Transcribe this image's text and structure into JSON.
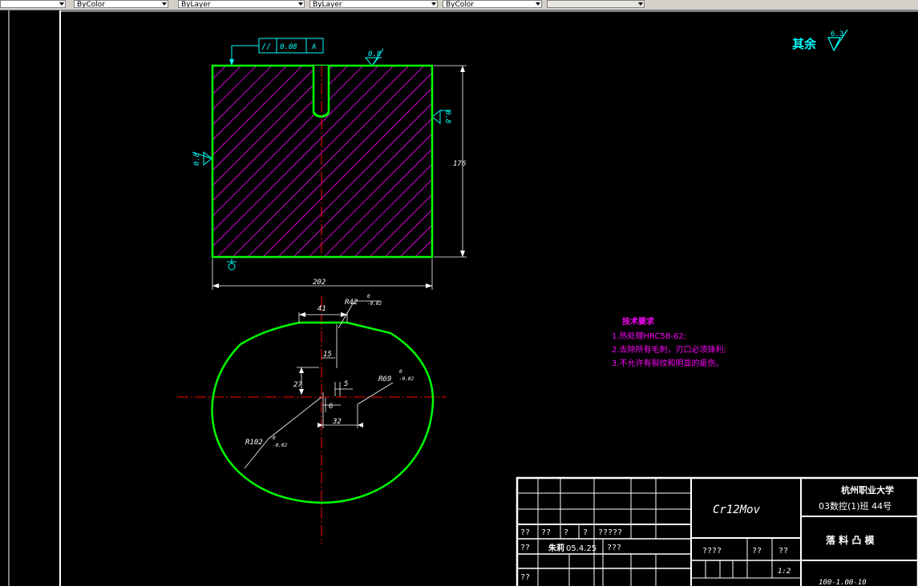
{
  "toolbar": {
    "color_label": "ByColor",
    "linetype_label": "ByLayer",
    "lineweight_label": "ByLayer",
    "plotstyle_label": "ByColor"
  },
  "drawing": {
    "rest_roughness_label": "其余",
    "rest_roughness_value": "6.3",
    "flatness_symbol": "//",
    "flatness_value": "0.08",
    "flatness_datum": "A",
    "roughness_top": "0.8",
    "roughness_left": "0.8",
    "roughness_right": "0.8",
    "dim_height": "176",
    "dim_width": "202",
    "dim_41": "41",
    "dim_R42": "R42",
    "dim_R42_tol_upper": "0",
    "dim_R42_tol_lower": "-0.02",
    "dim_15": "15",
    "dim_27": "27",
    "dim_5": "5",
    "dim_6": "6",
    "dim_32": "32",
    "dim_R69": "R69",
    "dim_R69_tol_upper": "0",
    "dim_R69_tol_lower": "-0.02",
    "dim_R102": "R102",
    "dim_R102_tol_upper": "0",
    "dim_R102_tol_lower": "-0.02"
  },
  "tech": {
    "title": "技术要求",
    "line1": "1.热处理HRC58-62;",
    "line2": "2.去除所有毛刺，刃口必须锋利;",
    "line3": "3.不允许有裂纹和明显的疵伤。"
  },
  "title_block": {
    "school": "杭州职业大学",
    "class_info": "03数控(1)班 44号",
    "material": "Cr12Mov",
    "part_name": "落 料 凸 模",
    "scale": "1:2",
    "drawing_no": "100-1.00-10",
    "designer": "朱莉",
    "date": "05.4.25",
    "q1": "??",
    "q2": "??",
    "q3": "?",
    "q4": "?",
    "q5": "?????",
    "q6": "??",
    "q7": "???",
    "q8": "??",
    "q9": "????",
    "q10": "??",
    "q11": "??"
  }
}
